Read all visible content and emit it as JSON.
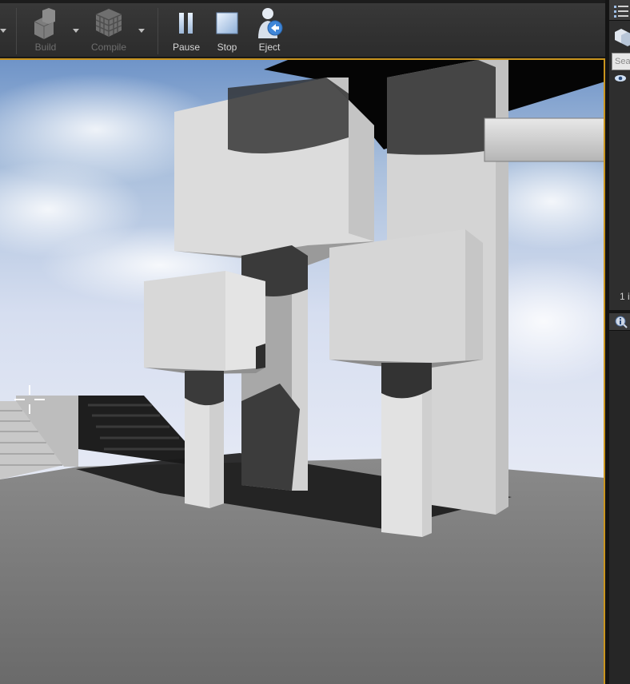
{
  "toolbar": {
    "build_label": "Build",
    "compile_label": "Compile",
    "pause_label": "Pause",
    "stop_label": "Stop",
    "eject_label": "Eject"
  },
  "outliner": {
    "search_placeholder": "Sea",
    "count_text": "1 i"
  },
  "icons": {
    "build": "build-icon",
    "compile": "compile-icon",
    "pause": "pause-icon",
    "stop": "stop-icon",
    "eject": "eject-icon",
    "outliner": "list-icon",
    "visibility": "eye-icon",
    "details": "info-icon"
  },
  "colors": {
    "viewport_border": "#c9941d",
    "toolbar_bg": "#333333",
    "panel_bg": "#262626"
  }
}
